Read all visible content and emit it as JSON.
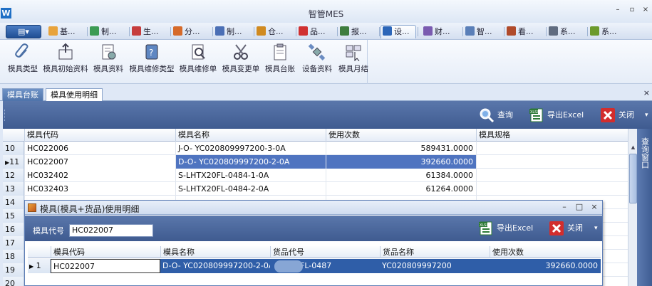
{
  "window": {
    "title": "智管MES",
    "logo": "W",
    "controls": {
      "min": "–",
      "restore": "▫",
      "close": "×"
    }
  },
  "menubar": {
    "menu_label": "▤▾",
    "tabs": [
      {
        "label": "基...",
        "icon": "folder-icon",
        "color": "#e8a33b"
      },
      {
        "label": "制...",
        "icon": "chart-icon",
        "color": "#3c9b54"
      },
      {
        "label": "生...",
        "icon": "doc-icon",
        "color": "#c63c3c"
      },
      {
        "label": "分...",
        "icon": "scissors-icon",
        "color": "#d66a2a"
      },
      {
        "label": "制...",
        "icon": "magnify-icon",
        "color": "#4b6fb5"
      },
      {
        "label": "仓...",
        "icon": "box-icon",
        "color": "#d08a20"
      },
      {
        "label": "品...",
        "icon": "diamond-icon",
        "color": "#d03030"
      },
      {
        "label": "报...",
        "icon": "report-icon",
        "color": "#3e7d3e"
      },
      {
        "label": "设...",
        "icon": "device-icon",
        "color": "#2c66b8"
      },
      {
        "label": "财...",
        "icon": "money-icon",
        "color": "#7a5bb0"
      },
      {
        "label": "智...",
        "icon": "cursor-icon",
        "color": "#5a7fb8"
      },
      {
        "label": "看...",
        "icon": "monitor-icon",
        "color": "#b04a2a"
      },
      {
        "label": "系...",
        "icon": "gear-icon",
        "color": "#606c80"
      },
      {
        "label": "系...",
        "icon": "tool-icon",
        "color": "#6c9a2c"
      }
    ],
    "active_index": 8
  },
  "ribbon": {
    "buttons": [
      {
        "label": "模具类型",
        "icon": "paperclip-icon"
      },
      {
        "label": "模具初始资料",
        "icon": "upload-box-icon"
      },
      {
        "label": "模具资料",
        "icon": "settings-doc-icon"
      },
      {
        "label": "模具维修类型",
        "icon": "help-doc-icon"
      },
      {
        "label": "模具维修单",
        "icon": "repair-doc-icon"
      },
      {
        "label": "模具变更单",
        "icon": "scissors-icon"
      },
      {
        "label": "模具台账",
        "icon": "clipboard-icon"
      },
      {
        "label": "设备资料",
        "icon": "satellite-icon"
      },
      {
        "label": "模具月结",
        "icon": "grid-cursor-icon"
      }
    ]
  },
  "doctabs": {
    "tabs": [
      "模具台账",
      "模具使用明细"
    ],
    "close": "×"
  },
  "toolbar": {
    "query": "查询",
    "export": "导出Excel",
    "close": "关闭",
    "dropdown": "▾"
  },
  "grid": {
    "columns": [
      "模具代码",
      "模具名称",
      "使用次数",
      "模具规格"
    ],
    "rows": [
      {
        "n": "10",
        "code": "HC022006",
        "name": "J-O- YC020809997200-3-0A",
        "count": "589431.0000",
        "spec": ""
      },
      {
        "n": "11",
        "code": "HC022007",
        "name": "D-O- YC020809997200-2-0A",
        "count": "392660.0000",
        "spec": "",
        "selected": true
      },
      {
        "n": "12",
        "code": "HC032402",
        "name": "S-LHTX20FL-0484-1-0A",
        "count": "61384.0000",
        "spec": ""
      },
      {
        "n": "13",
        "code": "HC032403",
        "name": "S-LHTX20FL-0484-2-0A",
        "count": "61264.0000",
        "spec": ""
      },
      {
        "n": "14",
        "code": "",
        "name": "",
        "count": "",
        "spec": ""
      },
      {
        "n": "15",
        "code": "",
        "name": "",
        "count": "",
        "spec": ""
      },
      {
        "n": "16",
        "code": "",
        "name": "",
        "count": "",
        "spec": ""
      },
      {
        "n": "17",
        "code": "",
        "name": "",
        "count": "",
        "spec": ""
      },
      {
        "n": "18",
        "code": "",
        "name": "",
        "count": "",
        "spec": ""
      },
      {
        "n": "19",
        "code": "",
        "name": "",
        "count": "",
        "spec": ""
      },
      {
        "n": "20",
        "code": "",
        "name": "",
        "count": "",
        "spec": ""
      }
    ],
    "current_marker": "▶"
  },
  "side_panel": {
    "label": "查询窗口"
  },
  "dialog": {
    "title": "模具(模具+货品)使用明细",
    "controls": {
      "min": "–",
      "max": "□",
      "close": "×"
    },
    "code_label": "模具代号",
    "code_value": "HC022007",
    "export": "导出Excel",
    "close": "关闭",
    "dropdown": "▾",
    "columns": [
      "模具代码",
      "模具名称",
      "货品代号",
      "货品名称",
      "使用次数"
    ],
    "row": {
      "n": "1",
      "marker": "▶",
      "code": "HC022007",
      "name": "D-O- YC020809997200-2-0A",
      "item_code": "FL-0487",
      "item_name": "YC020809997200",
      "count": "392660.0000"
    }
  }
}
